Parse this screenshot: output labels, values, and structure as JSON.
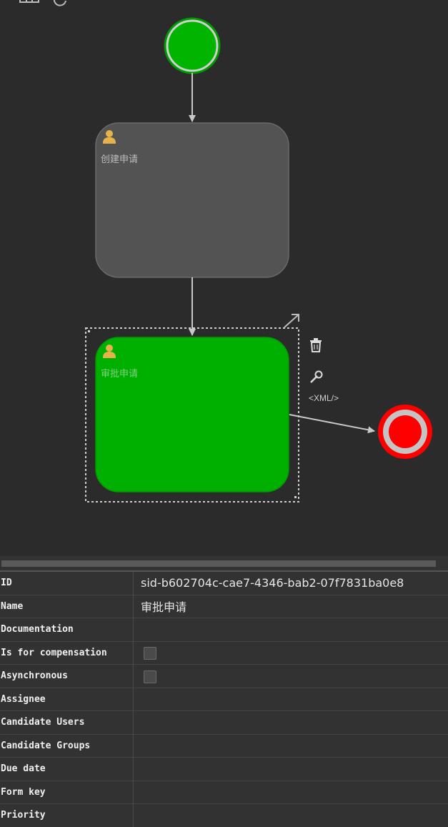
{
  "diagram": {
    "task1": {
      "label": "创建申请"
    },
    "task2": {
      "label": "审批申请"
    },
    "xml_link": "<XML/>",
    "colors": {
      "canvas_bg": "#2b2b2b",
      "start_event": "#00b400",
      "end_event": "#ff0000",
      "task_default": "#535353",
      "task_selected": "#00b000",
      "user_icon": "#e8b24a"
    }
  },
  "properties": {
    "rows": [
      {
        "key": "ID",
        "value": "sid-b602704c-cae7-4346-bab2-07f7831ba0e8"
      },
      {
        "key": "Name",
        "value": "审批申请"
      },
      {
        "key": "Documentation",
        "value": ""
      },
      {
        "key": "Is for compensation",
        "value": "",
        "checkbox": true
      },
      {
        "key": "Asynchronous",
        "value": "",
        "checkbox": true
      },
      {
        "key": "Assignee",
        "value": ""
      },
      {
        "key": "Candidate Users",
        "value": ""
      },
      {
        "key": "Candidate Groups",
        "value": ""
      },
      {
        "key": "Due date",
        "value": ""
      },
      {
        "key": "Form key",
        "value": ""
      },
      {
        "key": "Priority",
        "value": ""
      }
    ]
  }
}
